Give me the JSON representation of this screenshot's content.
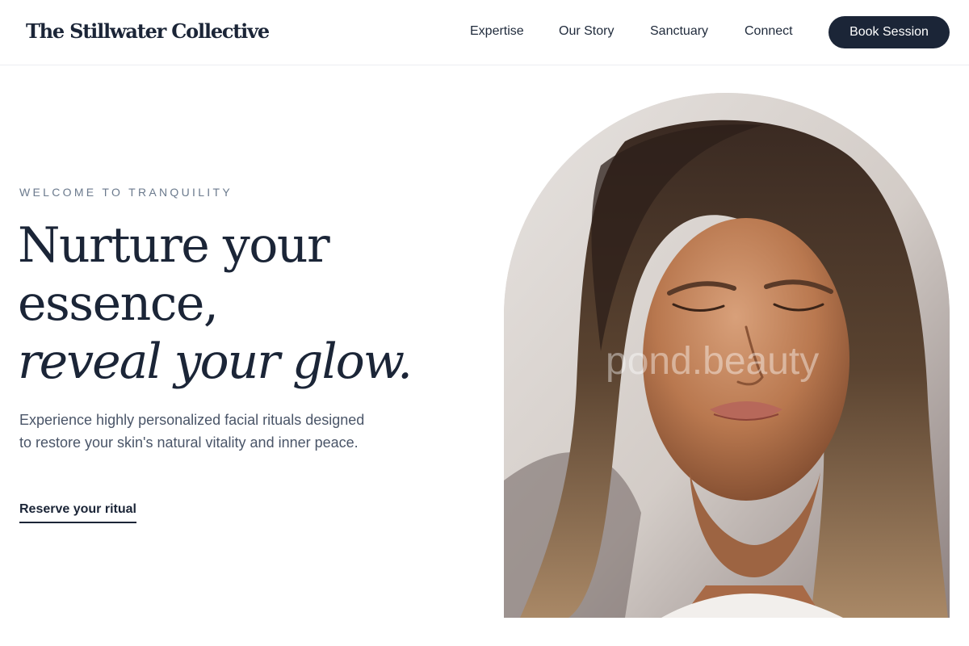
{
  "brand": {
    "name": "The Stillwater Collective"
  },
  "nav": {
    "items": [
      {
        "label": "Expertise"
      },
      {
        "label": "Our Story"
      },
      {
        "label": "Sanctuary"
      },
      {
        "label": "Connect"
      }
    ],
    "cta_label": "Book Session"
  },
  "hero": {
    "eyebrow": "WELCOME TO TRANQUILITY",
    "headline_line1": "Nurture your",
    "headline_line2": "essence,",
    "headline_line3": "reveal your glow.",
    "body": "Experience highly personalized facial rituals designed to restore your skin's natural vitality and inner peace.",
    "cta_label": "Reserve your ritual"
  },
  "image": {
    "watermark": "pond.beauty"
  },
  "colors": {
    "primary": "#1b2537",
    "eyebrow": "#6b7a8d",
    "body_text": "#4a5568",
    "border": "#eceef1",
    "background": "#ffffff"
  }
}
